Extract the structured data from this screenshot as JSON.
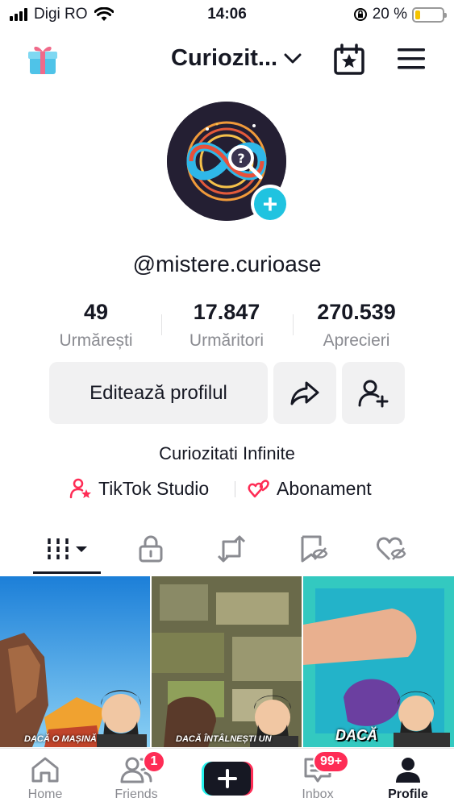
{
  "status_bar": {
    "carrier": "Digi RO",
    "time": "14:06",
    "battery_percent_text": "20 %",
    "battery_level": 0.2
  },
  "header": {
    "account_name": "Curiozit...",
    "icons": [
      "gift-icon",
      "chevron-down-icon",
      "calendar-star-icon",
      "menu-icon"
    ]
  },
  "profile": {
    "handle": "@mistere.curioase",
    "bio": "Curiozitati Infinite",
    "stats": [
      {
        "value": "49",
        "label": "Urmărești"
      },
      {
        "value": "17.847",
        "label": "Urmăritori"
      },
      {
        "value": "270.539",
        "label": "Aprecieri"
      }
    ],
    "edit_button": "Editează profilul",
    "links": [
      {
        "label": "TikTok Studio",
        "icon": "person-star-icon"
      },
      {
        "label": "Abonament",
        "icon": "hearts-icon"
      }
    ]
  },
  "tabs": [
    {
      "name": "videos",
      "icon": "grid-icon",
      "active": true
    },
    {
      "name": "private",
      "icon": "lock-icon"
    },
    {
      "name": "reposts",
      "icon": "repost-icon"
    },
    {
      "name": "favorites",
      "icon": "bookmark-hidden-icon"
    },
    {
      "name": "liked",
      "icon": "heart-hidden-icon"
    }
  ],
  "videos": [
    {
      "caption": "DACĂ O MAȘINĂ"
    },
    {
      "caption": "DACĂ ÎNTÂLNEȘTI UN"
    },
    {
      "caption": "DACĂ"
    }
  ],
  "bottom_nav": {
    "items": [
      {
        "label": "Home",
        "icon": "home-icon"
      },
      {
        "label": "Friends",
        "icon": "friends-icon",
        "badge": "1"
      },
      {
        "label": "",
        "icon": "plus-icon"
      },
      {
        "label": "Inbox",
        "icon": "inbox-icon",
        "badge": "99+"
      },
      {
        "label": "Profile",
        "icon": "profile-icon",
        "active": true
      }
    ]
  },
  "colors": {
    "accent": "#fe2c55",
    "avatar_plus": "#20c3e0",
    "battery": "#f5c400"
  }
}
